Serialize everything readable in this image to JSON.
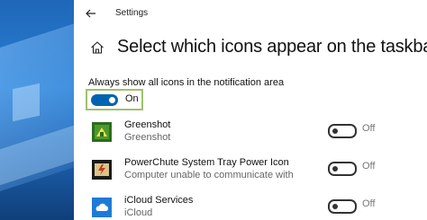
{
  "window": {
    "title": "Settings",
    "back_icon": "back-arrow-icon"
  },
  "header": {
    "home_icon": "home-icon",
    "title": "Select which icons appear on the taskbar"
  },
  "always_show": {
    "label": "Always show all icons in the notification area",
    "toggle_state": "On"
  },
  "apps": [
    {
      "name": "Greenshot",
      "description": "Greenshot",
      "icon": "greenshot-icon",
      "toggle_state": "Off"
    },
    {
      "name": "PowerChute System Tray Power Icon",
      "description": "Computer unable to communicate with",
      "icon": "powerchute-icon",
      "toggle_state": "Off"
    },
    {
      "name": "iCloud Services",
      "description": "iCloud",
      "icon": "icloud-icon",
      "toggle_state": "Off"
    }
  ],
  "colors": {
    "accent": "#0063b1",
    "focus_border": "#9dc26e",
    "desktop_blue": "#1f67b8"
  }
}
